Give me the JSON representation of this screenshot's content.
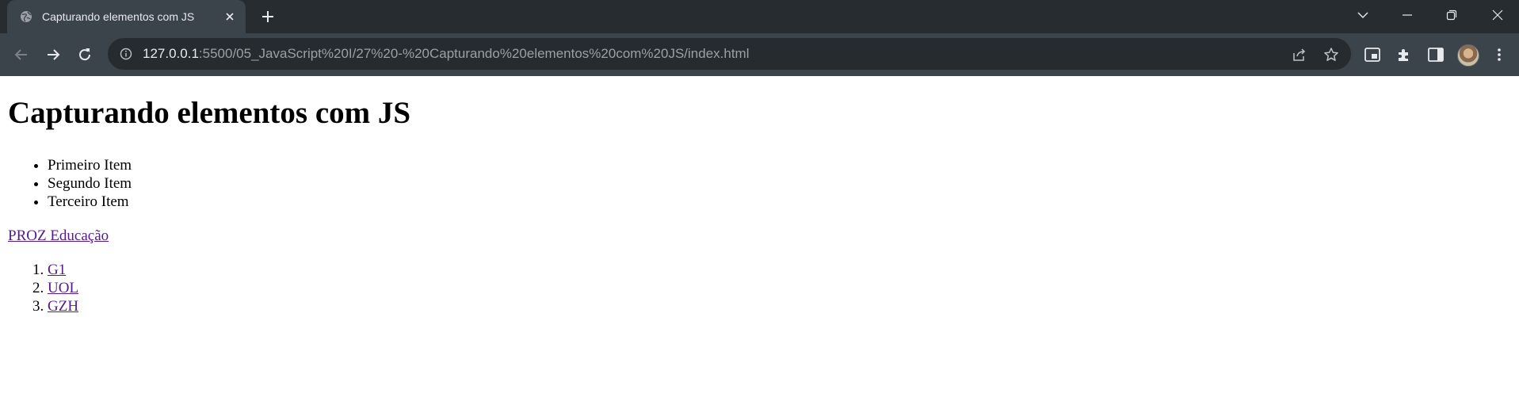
{
  "browser": {
    "tab": {
      "title": "Capturando elementos com JS",
      "favicon": "globe-icon",
      "close": "close-icon"
    },
    "new_tab": "plus-icon",
    "window_controls": [
      "chevron-down-icon",
      "minimize-icon",
      "restore-icon",
      "close-icon"
    ],
    "address_bar": {
      "host": "127.0.0.1",
      "path": ":5500/05_JavaScript%20I/27%20-%20Capturando%20elementos%20com%20JS/index.html",
      "info_icon": "info-icon"
    },
    "colors": {
      "tabstrip": "#272c30",
      "toolbar": "#3c444b",
      "omnibox": "#262b2f",
      "link_visited": "#551a8b"
    }
  },
  "page": {
    "heading": "Capturando elementos com JS",
    "bullet_items": [
      "Primeiro Item",
      "Segundo Item",
      "Terceiro Item"
    ],
    "proz_link": "PROZ Educação",
    "ordered_links": [
      "G1",
      "UOL",
      "GZH"
    ]
  }
}
